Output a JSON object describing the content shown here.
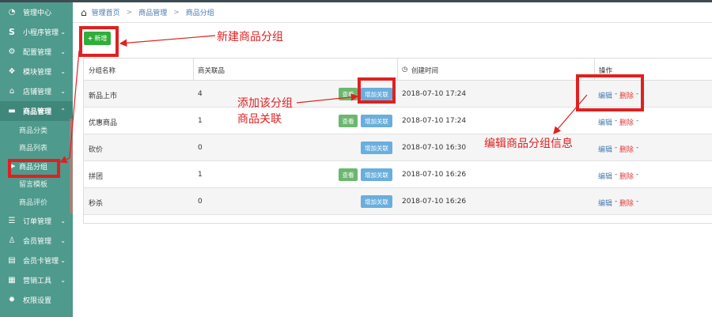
{
  "breadcrumb": {
    "home": "管理首页",
    "section": "商品管理",
    "page": "商品分组"
  },
  "sidebar": {
    "items": [
      {
        "label": "管理中心",
        "icon": "dashboard-icon",
        "glyph": "◔",
        "chev": ""
      },
      {
        "label": "小程序管理",
        "icon": "miniapp-s-icon",
        "glyph": "S",
        "chev": "⌄"
      },
      {
        "label": "配置管理",
        "icon": "gears-icon",
        "glyph": "⚙",
        "chev": "⌄"
      },
      {
        "label": "模块管理",
        "icon": "cubes-icon",
        "glyph": "❖",
        "chev": "⌄"
      },
      {
        "label": "店铺管理",
        "icon": "store-icon",
        "glyph": "⌂",
        "chev": "⌄"
      },
      {
        "label": "商品管理",
        "icon": "folder-icon",
        "glyph": "▬",
        "chev": "⌃"
      }
    ],
    "submenu": [
      "商品分类",
      "商品列表",
      "商品分组",
      "留言模板",
      "商品评价"
    ],
    "items_after": [
      {
        "label": "订单管理",
        "icon": "order-list-icon",
        "glyph": "☰",
        "chev": "⌄"
      },
      {
        "label": "会员管理",
        "icon": "user-icon",
        "glyph": "♙",
        "chev": "⌄"
      },
      {
        "label": "会员卡管理",
        "icon": "id-card-icon",
        "glyph": "▤",
        "chev": "⌄"
      },
      {
        "label": "营销工具",
        "icon": "briefcase-icon",
        "glyph": "▦",
        "chev": "⌄"
      },
      {
        "label": "权限设置",
        "icon": "cog-icon",
        "glyph": "✹",
        "chev": ""
      }
    ]
  },
  "toolbar": {
    "new_label": "新增",
    "new_plus": "+"
  },
  "table": {
    "headers": [
      "分组名称",
      "商关联品",
      "创建时间",
      "操作"
    ],
    "clock_glyph": "◷",
    "view_label": "查看",
    "add_label": "增加关联",
    "edit_label": "编辑",
    "delete_label": "删除",
    "rows": [
      {
        "name": "新品上市",
        "count": "4",
        "has_view": true,
        "time": "2018-07-10 17:24"
      },
      {
        "name": "优惠商品",
        "count": "1",
        "has_view": true,
        "time": "2018-07-10 17:24"
      },
      {
        "name": "砍价",
        "count": "0",
        "has_view": false,
        "time": "2018-07-10 16:30"
      },
      {
        "name": "拼团",
        "count": "1",
        "has_view": true,
        "time": "2018-07-10 16:26"
      },
      {
        "name": "秒杀",
        "count": "0",
        "has_view": false,
        "time": "2018-07-10 16:26"
      }
    ]
  },
  "annotations": {
    "new_group": "新建商品分组",
    "add_relation_line1": "添加该分组",
    "add_relation_line2": "商品关联",
    "edit_group": "编辑商品分组信息"
  },
  "colors": {
    "sidebar": "#4e9a8c",
    "primary_green": "#2fae3a",
    "add_blue": "#6aaede",
    "annotation_red": "#e02020"
  }
}
